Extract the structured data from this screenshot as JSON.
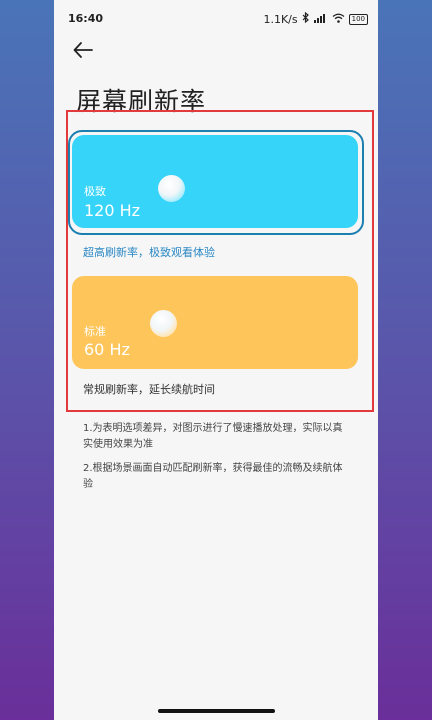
{
  "status_bar": {
    "time": "16:40",
    "network_speed": "1.1K/s",
    "battery_level": "100"
  },
  "header": {
    "title": "屏幕刷新率"
  },
  "options": [
    {
      "label": "极致",
      "value": "120 Hz",
      "description": "超高刷新率，极致观看体验",
      "color": "#35d4f8",
      "selected": true
    },
    {
      "label": "标准",
      "value": "60 Hz",
      "description": "常规刷新率，延长续航时间",
      "color": "#fdc55a",
      "selected": false
    }
  ],
  "notes": [
    "1.为表明选项差异，对图示进行了慢速播放处理，实际以真实使用效果为准",
    "2.根据场景画面自动匹配刷新率，获得最佳的流畅及续航体验"
  ],
  "colors": {
    "highlight_border": "#e23a3a",
    "selected_ring": "#1b7fb0",
    "selected_description": "#2a88c4"
  },
  "icons": {
    "back": "arrow-left-icon",
    "bluetooth": "bluetooth-icon",
    "signal": "signal-icon",
    "wifi": "wifi-icon",
    "battery": "battery-icon"
  }
}
